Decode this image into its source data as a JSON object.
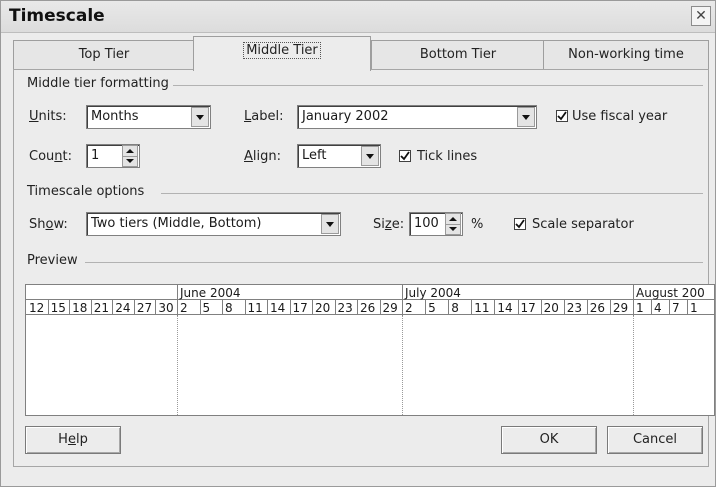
{
  "window": {
    "title": "Timescale",
    "close_glyph": "✕"
  },
  "tabs": [
    {
      "label": "Top Tier",
      "active": false
    },
    {
      "label": "Middle Tier",
      "active": true
    },
    {
      "label": "Bottom Tier",
      "active": false
    },
    {
      "label": "Non-working time",
      "active": false
    }
  ],
  "formatting": {
    "group_title": "Middle tier formatting",
    "units_label": "Units:",
    "units_value": "Months",
    "label_label": "Label:",
    "label_value": "January 2002",
    "use_fiscal_year_label": "Use fiscal year",
    "use_fiscal_year_checked": true,
    "count_label": "Count:",
    "count_value": "1",
    "align_label": "Align:",
    "align_value": "Left",
    "tick_lines_label": "Tick lines",
    "tick_lines_checked": true
  },
  "options": {
    "group_title": "Timescale options",
    "show_label": "Show:",
    "show_value": "Two tiers (Middle, Bottom)",
    "size_label": "Size:",
    "size_value": "100",
    "size_unit": "%",
    "scale_separator_label": "Scale separator",
    "scale_separator_checked": true
  },
  "preview": {
    "group_title": "Preview",
    "months": [
      "June 2004",
      "July 2004",
      "August 200"
    ],
    "days_before": [
      "12",
      "15",
      "18",
      "21",
      "24",
      "27",
      "30"
    ],
    "days_june": [
      "2",
      "5",
      "8",
      "11",
      "14",
      "17",
      "20",
      "23",
      "26",
      "29"
    ],
    "days_july": [
      "2",
      "5",
      "8",
      "11",
      "14",
      "17",
      "20",
      "23",
      "26",
      "29"
    ],
    "days_august": [
      "1",
      "4",
      "7",
      "1"
    ]
  },
  "buttons": {
    "help": "Help",
    "ok": "OK",
    "cancel": "Cancel"
  },
  "icons": {
    "checkbox": "checkmark-icon",
    "dropdown": "chevron-down-icon",
    "spinner": "spin-arrows-icon"
  }
}
